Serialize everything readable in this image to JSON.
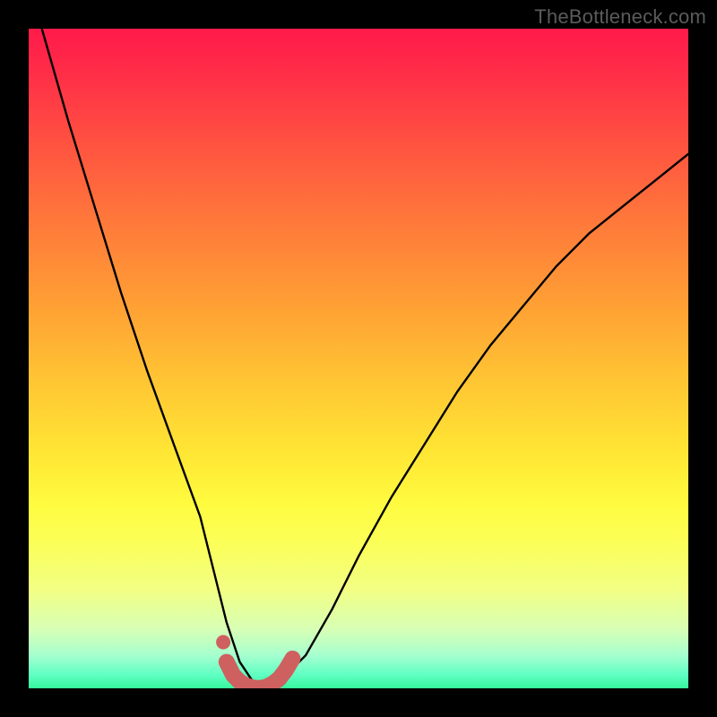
{
  "watermark": "TheBottleneck.com",
  "colors": {
    "frame": "#000000",
    "curve": "#000000",
    "marker": "#cf6060",
    "gradient_top": "#ff1a4a",
    "gradient_bottom": "#37f69d"
  },
  "chart_data": {
    "type": "line",
    "title": "",
    "xlabel": "",
    "ylabel": "",
    "xlim": [
      0,
      100
    ],
    "ylim": [
      0,
      100
    ],
    "grid": false,
    "legend": false,
    "notes": "Unlabeled bottleneck-style V-curve over rainbow gradient. No axis ticks or numeric labels are rendered; x/y values below are visual estimates in percent of plot area (0,0 = bottom-left).",
    "series": [
      {
        "name": "bottleneck-curve",
        "x": [
          2,
          6,
          10,
          14,
          18,
          22,
          26,
          28,
          30,
          32,
          34,
          36,
          38,
          42,
          46,
          50,
          55,
          60,
          65,
          70,
          75,
          80,
          85,
          90,
          95,
          100
        ],
        "y": [
          100,
          86,
          73,
          60,
          48,
          37,
          26,
          18,
          10,
          4,
          1,
          0,
          1,
          5,
          12,
          20,
          29,
          37,
          45,
          52,
          58,
          64,
          69,
          73,
          77,
          81
        ]
      }
    ],
    "highlight": {
      "name": "valley-marker",
      "x": [
        30,
        31,
        32,
        33,
        34,
        35,
        36,
        37,
        38,
        39,
        40
      ],
      "y": [
        4,
        2,
        1,
        0.4,
        0.1,
        0,
        0.2,
        0.7,
        1.5,
        2.8,
        4.5
      ]
    }
  }
}
